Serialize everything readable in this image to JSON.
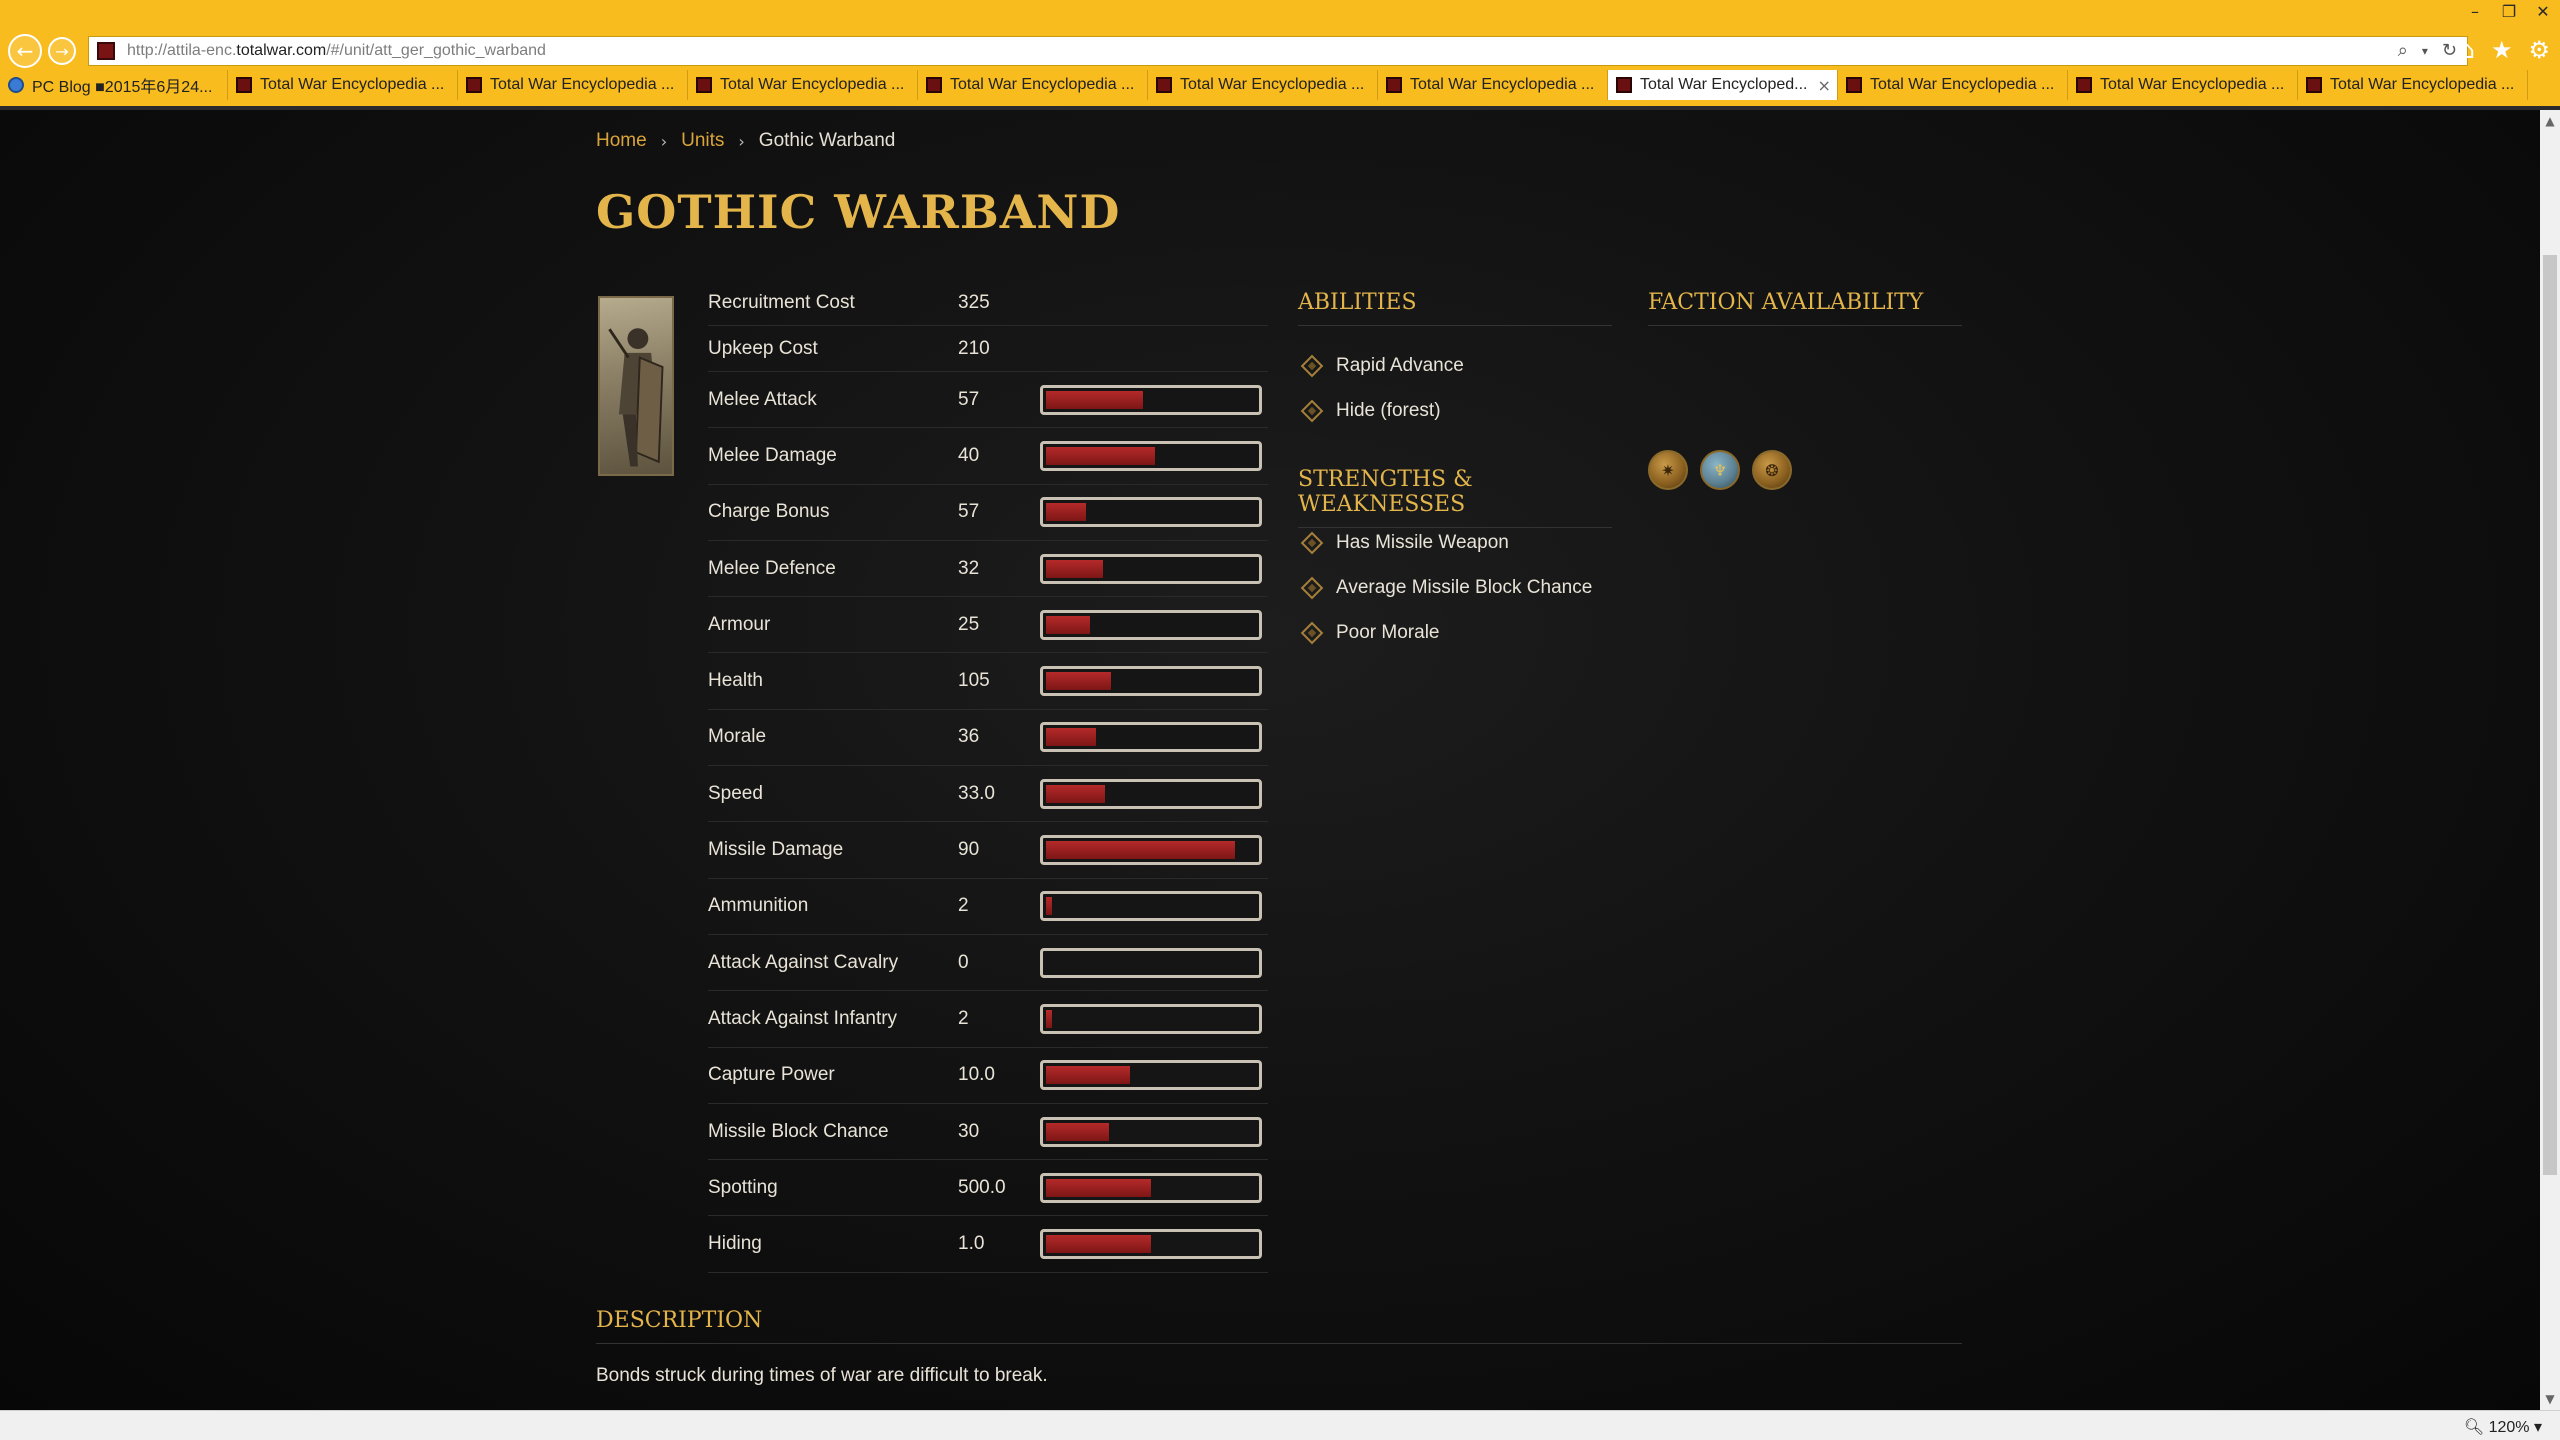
{
  "browser": {
    "url_prefix": "http://attila-enc.",
    "url_domain": "totalwar.com",
    "url_suffix": "/#/unit/att_ger_gothic_warband",
    "tabs": [
      {
        "label": "PC Blog ■2015年6月24...",
        "active": false,
        "blog": true
      },
      {
        "label": "Total War Encyclopedia ...",
        "active": false
      },
      {
        "label": "Total War Encyclopedia ...",
        "active": false
      },
      {
        "label": "Total War Encyclopedia ...",
        "active": false
      },
      {
        "label": "Total War Encyclopedia ...",
        "active": false
      },
      {
        "label": "Total War Encyclopedia ...",
        "active": false
      },
      {
        "label": "Total War Encyclopedia ...",
        "active": false
      },
      {
        "label": "Total War Encycloped...",
        "active": true
      },
      {
        "label": "Total War Encyclopedia ...",
        "active": false
      },
      {
        "label": "Total War Encyclopedia ...",
        "active": false
      },
      {
        "label": "Total War Encyclopedia ...",
        "active": false
      }
    ],
    "zoom_label": "120%"
  },
  "breadcrumb": {
    "home": "Home",
    "units": "Units",
    "current": "Gothic Warband"
  },
  "title": "GOTHIC WARBAND",
  "stats": [
    {
      "label": "Recruitment Cost",
      "value": "325",
      "bar": null
    },
    {
      "label": "Upkeep Cost",
      "value": "210",
      "bar": null
    },
    {
      "label": "Melee Attack",
      "value": "57",
      "bar": 0.46
    },
    {
      "label": "Melee Damage",
      "value": "40",
      "bar": 0.52
    },
    {
      "label": "Charge Bonus",
      "value": "57",
      "bar": 0.19
    },
    {
      "label": "Melee Defence",
      "value": "32",
      "bar": 0.27
    },
    {
      "label": "Armour",
      "value": "25",
      "bar": 0.21
    },
    {
      "label": "Health",
      "value": "105",
      "bar": 0.31
    },
    {
      "label": "Morale",
      "value": "36",
      "bar": 0.24
    },
    {
      "label": "Speed",
      "value": "33.0",
      "bar": 0.28
    },
    {
      "label": "Missile Damage",
      "value": "90",
      "bar": 0.9
    },
    {
      "label": "Ammunition",
      "value": "2",
      "bar": 0.03
    },
    {
      "label": "Attack Against Cavalry",
      "value": "0",
      "bar": 0.0
    },
    {
      "label": "Attack Against Infantry",
      "value": "2",
      "bar": 0.03
    },
    {
      "label": "Capture Power",
      "value": "10.0",
      "bar": 0.4
    },
    {
      "label": "Missile Block Chance",
      "value": "30",
      "bar": 0.3
    },
    {
      "label": "Spotting",
      "value": "500.0",
      "bar": 0.5
    },
    {
      "label": "Hiding",
      "value": "1.0",
      "bar": 0.5
    }
  ],
  "abilities": {
    "heading": "ABILITIES",
    "items": [
      "Rapid Advance",
      "Hide (forest)"
    ]
  },
  "strengths": {
    "heading": "STRENGTHS & WEAKNESSES",
    "items": [
      "Has Missile Weapon",
      "Average Missile Block Chance",
      "Poor Morale"
    ]
  },
  "factions": {
    "heading": "FACTION AVAILABILITY"
  },
  "description": {
    "heading": "DESCRIPTION",
    "text": "Bonds struck during times of war are difficult to break."
  },
  "colors": {
    "accent_gold": "#e3b54a",
    "bar_red": "#b52a2a",
    "chrome_yellow": "#f9bc1e"
  }
}
